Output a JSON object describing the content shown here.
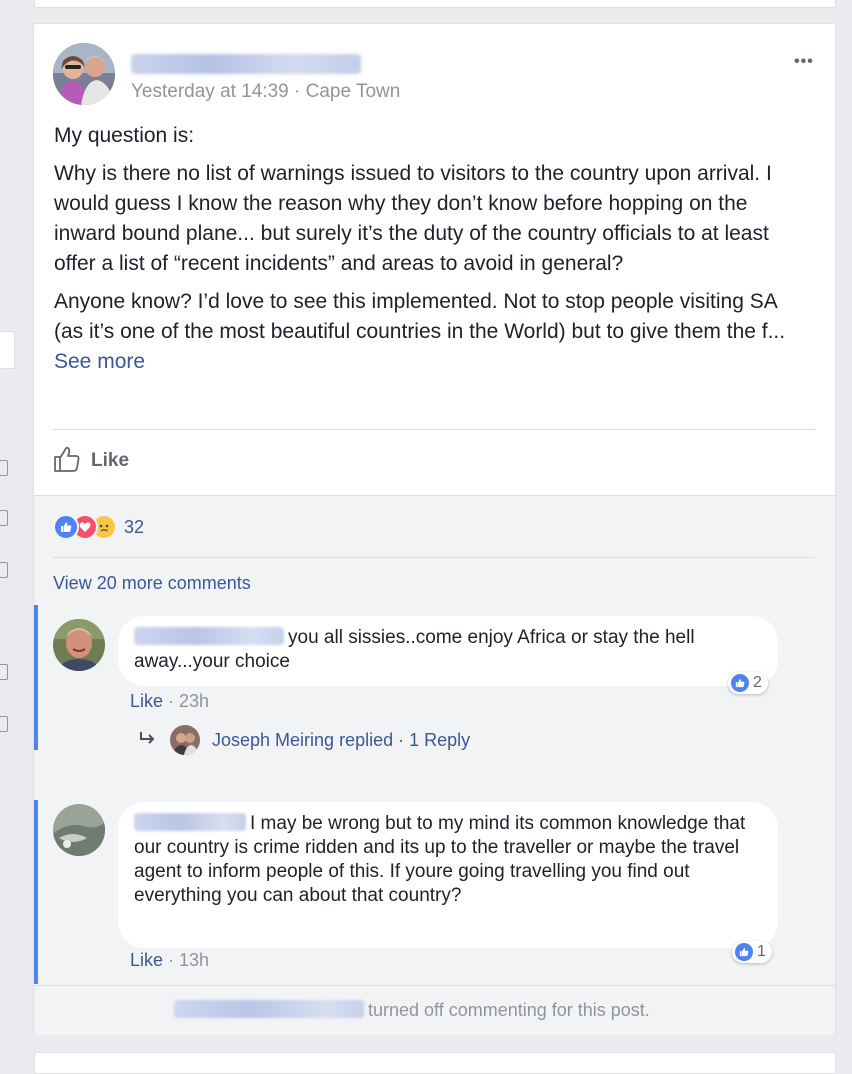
{
  "post": {
    "meta": "Yesterday at 14:39 · Cape Town",
    "more_label": "•••",
    "paragraphs": [
      "My question is:",
      "Why is there no list of warnings issued to visitors to the country upon arrival. I would guess I know the reason why they don’t know before hopping on the inward bound plane... but surely it’s the duty of the country officials to at least offer a list of “recent incidents” and areas to avoid in general?",
      "Anyone know? I’d love to see this implemented. Not to stop people visiting SA (as it’s one of the most beautiful countries in the World) but to give them the f..."
    ],
    "see_more": "See more",
    "like_label": "Like"
  },
  "reactions": {
    "count": "32",
    "types": [
      "like-icon",
      "love-icon",
      "sad-icon"
    ]
  },
  "comments": {
    "view_more": "View 20 more comments",
    "items": [
      {
        "text": "you all sissies..come enjoy Africa or stay the hell away...your choice",
        "like_label": "Like",
        "time": "23h",
        "reaction_count": "2"
      },
      {
        "text": "I may be wrong but to my mind its common knowledge that our country is crime ridden and its up to the traveller or maybe the travel agent to inform people of this. If youre going travelling you find out everything you can about that country?",
        "like_label": "Like",
        "time": "13h",
        "reaction_count": "1"
      }
    ],
    "reply": {
      "text": "Joseph Meiring replied · 1 Reply"
    },
    "closed_text": "turned off commenting for this post."
  },
  "colors": {
    "link": "#385898",
    "accent": "#4f83f0",
    "muted": "#90949c",
    "background": "#e9ebee"
  }
}
